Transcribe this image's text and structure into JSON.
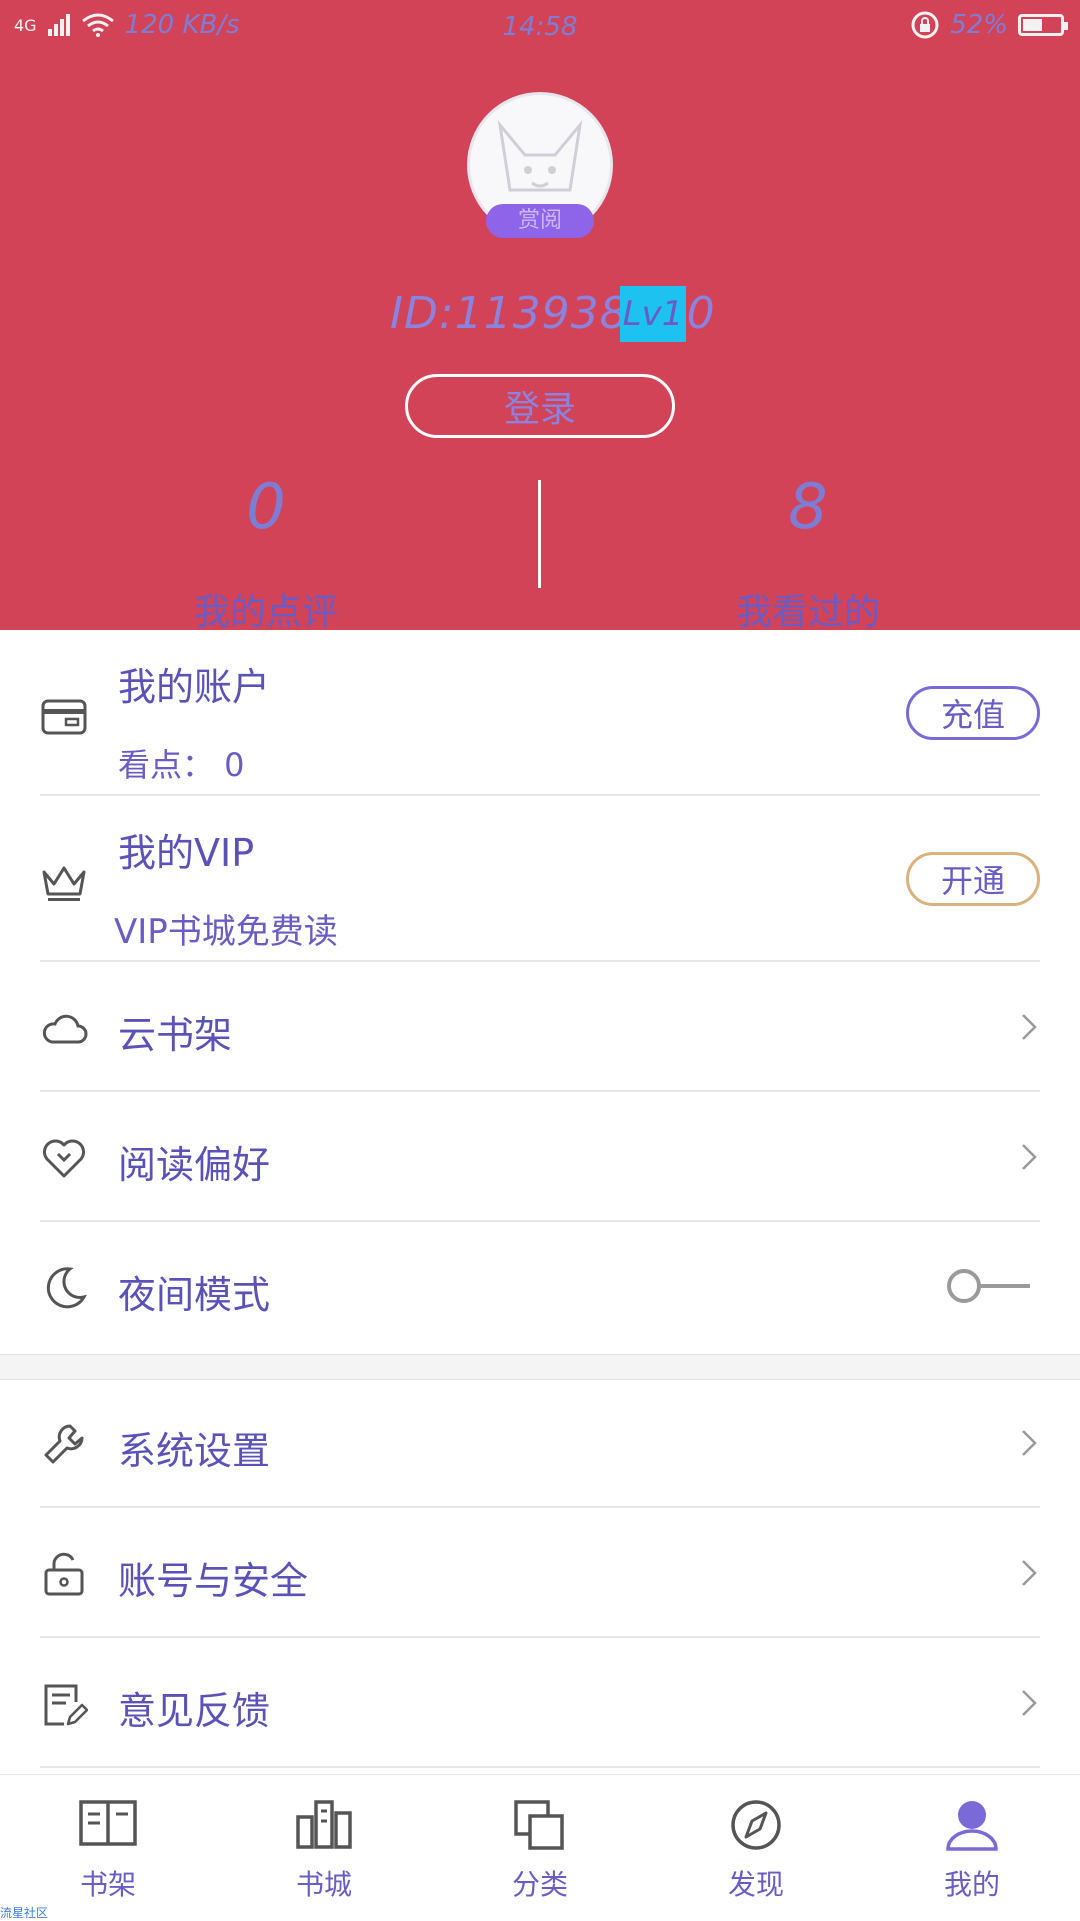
{
  "status_bar": {
    "network": "4G",
    "speed": "120 KB/s",
    "time": "14:58",
    "battery": "52%",
    "battery_level": 0.52
  },
  "profile": {
    "avatar_badge": "赏阅",
    "user_id": "ID:113938120",
    "level": "Lv1",
    "login_label": "登录"
  },
  "stats": [
    {
      "value": "0",
      "label": "我的点评"
    },
    {
      "value": "8",
      "label": "我看过的"
    }
  ],
  "account": {
    "title": "我的账户",
    "subtitle": "看点： 0",
    "button": "充值",
    "icon": "wallet-icon"
  },
  "vip": {
    "title": "我的VIP",
    "subtitle": "VIP书城免费读",
    "button": "开通",
    "icon": "crown-icon"
  },
  "menu": [
    {
      "label": "云书架",
      "icon": "cloud-icon"
    },
    {
      "label": "阅读偏好",
      "icon": "heart-icon"
    },
    {
      "label": "夜间模式",
      "icon": "moon-icon",
      "toggle": false
    }
  ],
  "menu2": [
    {
      "label": "系统设置",
      "icon": "wrench-icon"
    },
    {
      "label": "账号与安全",
      "icon": "lock-icon"
    },
    {
      "label": "意见反馈",
      "icon": "feedback-icon"
    }
  ],
  "bottom_nav": [
    {
      "label": "书架",
      "icon": "bookshelf-icon"
    },
    {
      "label": "书城",
      "icon": "bookstore-icon"
    },
    {
      "label": "分类",
      "icon": "category-icon"
    },
    {
      "label": "发现",
      "icon": "compass-icon"
    },
    {
      "label": "我的",
      "icon": "user-icon",
      "active": true
    }
  ],
  "colors": {
    "header": "#d34358",
    "accent": "#6a5cc4",
    "vip_border": "#d9b27c",
    "level_badge": "#1ec2f0",
    "active_nav": "#7a6ad8"
  },
  "watermark": "流星社区"
}
